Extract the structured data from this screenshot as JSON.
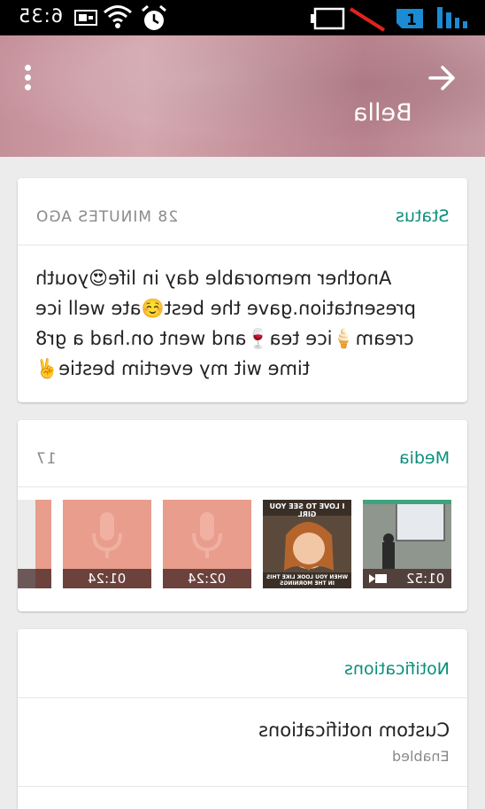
{
  "status_bar": {
    "time": "6:35",
    "icons": [
      "usb-icon",
      "wifi-icon",
      "alarm-icon",
      "battery-icon",
      "sim-icon",
      "signal-icon"
    ]
  },
  "header": {
    "contact_name": "Bella",
    "accent": "#c7939c"
  },
  "status_card": {
    "title": "Status",
    "time_ago": "28 MINUTES AGO",
    "text": "Another memorable day in life😍youth presentation.gave the best☺️ate well ice cream🍦ice tea🍷and went on.had a gr8 time wit my evertim bestie✌️"
  },
  "media_card": {
    "title": "Media",
    "count": "17",
    "items": [
      {
        "kind": "video",
        "duration": "01:52"
      },
      {
        "kind": "image",
        "caption_top": "I LOVE TO SEE YOU GIRL",
        "caption_bottom": "WHEN YOU LOOK LIKE THIS IN THE MORNINGS"
      },
      {
        "kind": "audio",
        "duration": "02:24"
      },
      {
        "kind": "audio",
        "duration": "01:24"
      },
      {
        "kind": "audio",
        "duration": ""
      }
    ]
  },
  "notifications_card": {
    "title": "Notifications",
    "rows": [
      {
        "label": "Custom notifications",
        "value": "Enabled"
      }
    ]
  },
  "colors": {
    "teal": "#0a8f7c",
    "audio_tile": "#e99d8d",
    "background": "#ececec"
  }
}
